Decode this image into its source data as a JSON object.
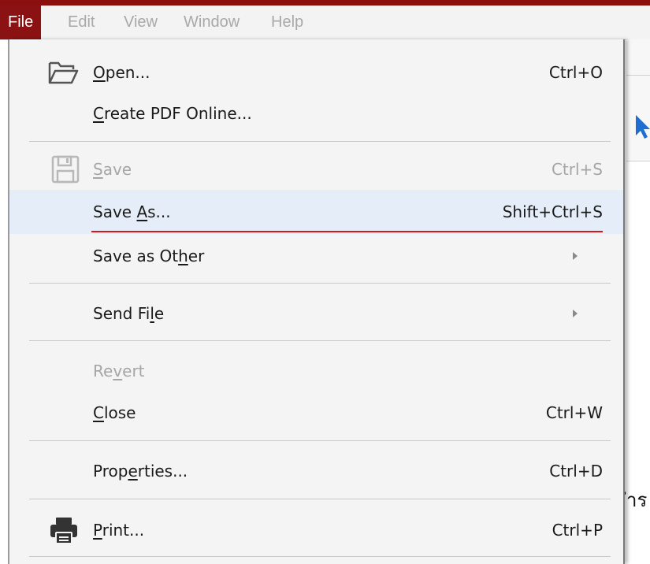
{
  "menubar": {
    "items": [
      {
        "label": "File",
        "active": true
      },
      {
        "label": "Edit",
        "active": false
      },
      {
        "label": "View",
        "active": false
      },
      {
        "label": "Window",
        "active": false
      },
      {
        "label": "Help",
        "active": false
      }
    ]
  },
  "file_menu": {
    "items": [
      {
        "label": "Open...",
        "mnemonic": "O",
        "shortcut": "Ctrl+O",
        "icon": "folder-open-icon",
        "enabled": true
      },
      {
        "label": "Create PDF Online...",
        "mnemonic": "C",
        "shortcut": "",
        "enabled": true
      },
      {
        "label": "Save",
        "mnemonic": "S",
        "shortcut": "Ctrl+S",
        "icon": "save-disk-icon",
        "enabled": false
      },
      {
        "label": "Save As...",
        "mnemonic": "A",
        "shortcut": "Shift+Ctrl+S",
        "enabled": true,
        "highlighted": true
      },
      {
        "label": "Save as Other",
        "mnemonic": "h",
        "submenu": true,
        "enabled": true
      },
      {
        "label": "Send File",
        "mnemonic": "l",
        "submenu": true,
        "enabled": true
      },
      {
        "label": "Revert",
        "mnemonic": "v",
        "shortcut": "",
        "enabled": false
      },
      {
        "label": "Close",
        "mnemonic": "C",
        "shortcut": "Ctrl+W",
        "enabled": true
      },
      {
        "label": "Properties...",
        "mnemonic": "e",
        "shortcut": "Ctrl+D",
        "enabled": true
      },
      {
        "label": "Print...",
        "mnemonic": "P",
        "shortcut": "Ctrl+P",
        "icon": "printer-icon",
        "enabled": true
      }
    ]
  },
  "background": {
    "partial_text": "ำร"
  },
  "colors": {
    "menubar_active": "#8b1212",
    "highlight": "#e5eef8",
    "annotation_underline": "#d91515",
    "disabled_text": "#a6a6a6"
  }
}
